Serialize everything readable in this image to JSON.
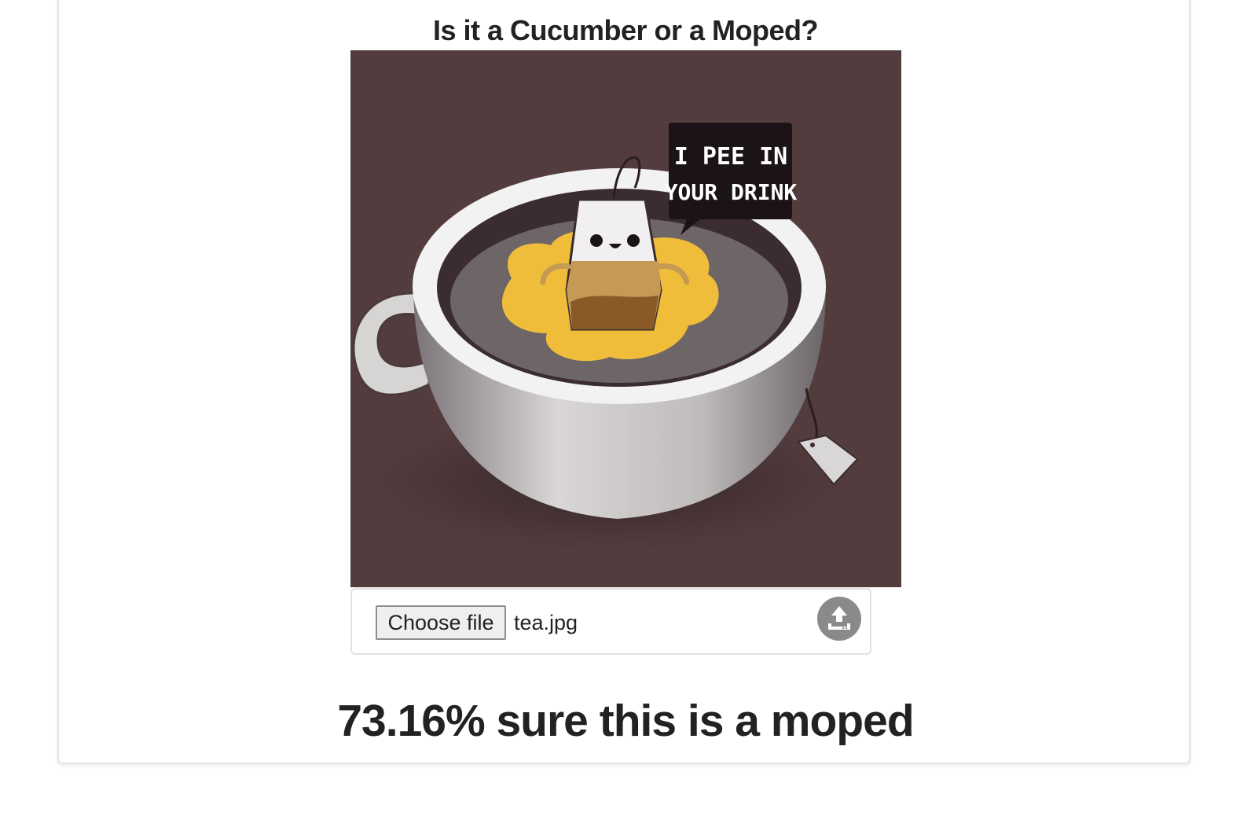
{
  "page": {
    "title": "Is it a Cucumber or a Moped?"
  },
  "preview_image": {
    "speech_bubble_line1": "I PEE IN",
    "speech_bubble_line2": "YOUR DRINK",
    "background_color": "#533c3e"
  },
  "upload": {
    "choose_file_label": "Choose file",
    "selected_file_name": "tea.jpg",
    "upload_icon": "upload-icon"
  },
  "result": {
    "text": "73.16% sure this is a moped"
  }
}
